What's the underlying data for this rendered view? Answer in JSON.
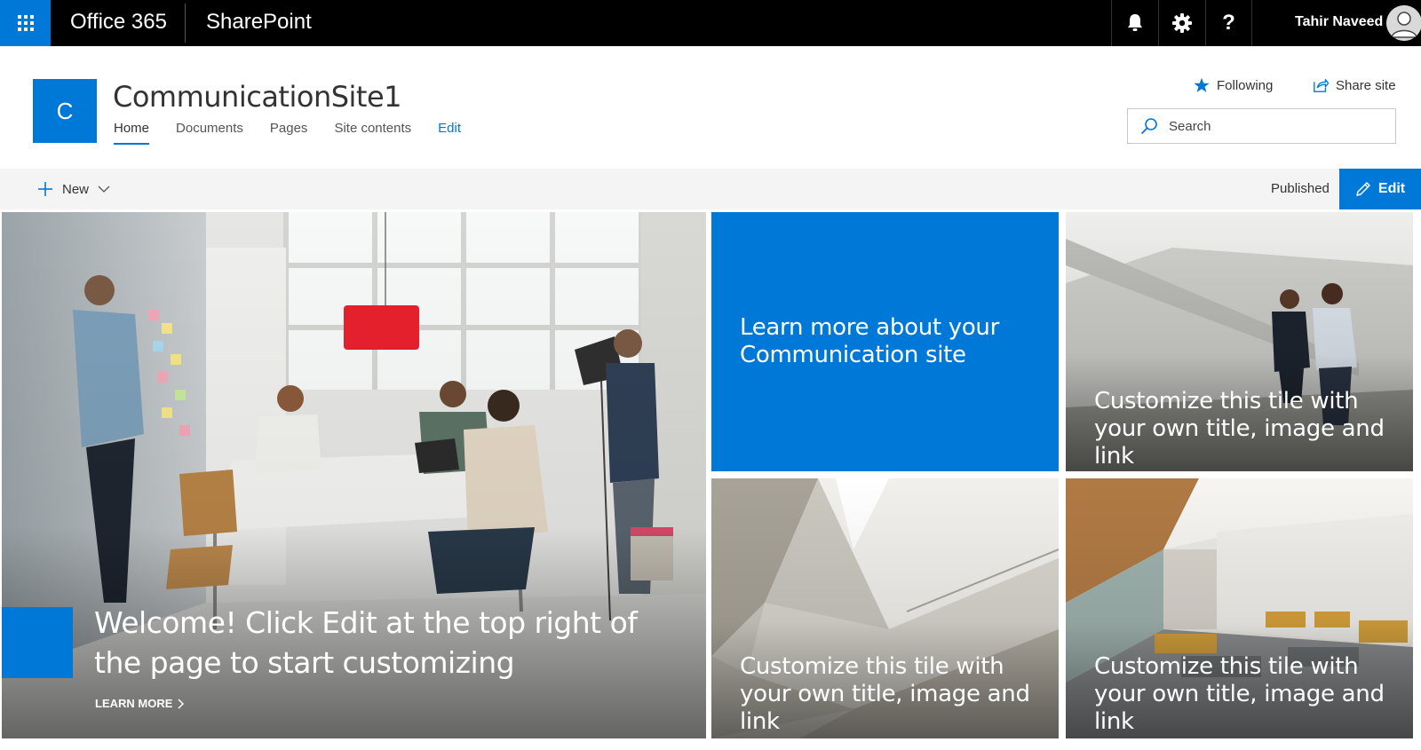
{
  "suite_bar": {
    "brand": "Office 365",
    "app": "SharePoint",
    "user_name": "Tahir Naveed",
    "help_glyph": "?",
    "icons": [
      "app-launcher-icon",
      "bell-icon",
      "gear-icon",
      "help-icon",
      "avatar-icon"
    ]
  },
  "site": {
    "logo_letter": "C",
    "title": "CommunicationSite1",
    "nav": [
      {
        "label": "Home",
        "active": true
      },
      {
        "label": "Documents"
      },
      {
        "label": "Pages"
      },
      {
        "label": "Site contents"
      },
      {
        "label": "Edit"
      }
    ],
    "following_label": "Following",
    "share_label": "Share site",
    "search_placeholder": "Search"
  },
  "command_bar": {
    "new_label": "New",
    "status": "Published",
    "edit_label": "Edit"
  },
  "hero": {
    "main_title": "Welcome! Click Edit at the top right of the page to start customizing",
    "learn_more": "LEARN MORE",
    "tiles": [
      {
        "text": "Learn more about your Communication site"
      },
      {
        "text": "Customize this tile with your own title, image and link"
      },
      {
        "text": "Customize this tile with your own title, image and link"
      },
      {
        "text": "Customize this tile with your own title, image and link"
      }
    ]
  },
  "colors": {
    "accent": "#0078d7",
    "suite_bar": "#000000",
    "command_bar": "#f4f4f4"
  }
}
